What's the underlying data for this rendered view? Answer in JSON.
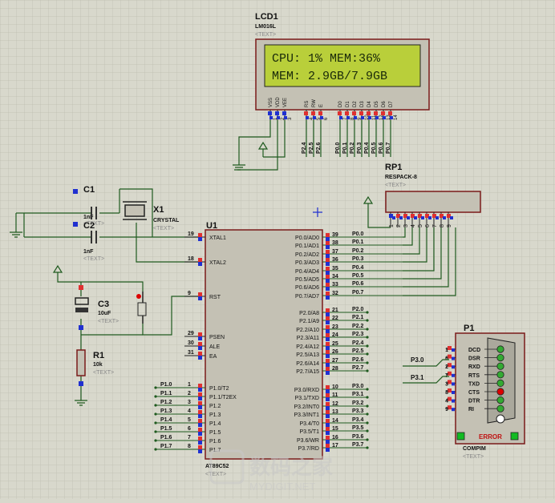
{
  "lcd": {
    "ref": "LCD1",
    "model": "LM016L",
    "text_tag": "<TEXT>",
    "line1": "CPU: 1% MEM:36%",
    "line2": "MEM: 2.9GB/7.9GB",
    "pin_names": [
      "VSS",
      "VDD",
      "VEE",
      "RS",
      "RW",
      "E",
      "D0",
      "D1",
      "D2",
      "D3",
      "D4",
      "D5",
      "D6",
      "D7"
    ],
    "pin_numbers": [
      "1",
      "2",
      "3",
      "4",
      "5",
      "6",
      "7",
      "8",
      "9",
      "10",
      "11",
      "12",
      "13",
      "14"
    ],
    "net_labels": [
      "P2.4",
      "P2.5",
      "P2.6",
      "P0.0",
      "P0.1",
      "P0.2",
      "P0.3",
      "P0.4",
      "P0.5",
      "P0.6",
      "P0.7"
    ]
  },
  "rp1": {
    "ref": "RP1",
    "model": "RESPACK-8",
    "text_tag": "<TEXT>",
    "pins": [
      "1",
      "2",
      "3",
      "4",
      "5",
      "6",
      "7",
      "8",
      "9"
    ]
  },
  "c1": {
    "ref": "C1",
    "value": "1nF",
    "text_tag": "<TEXT>"
  },
  "c2": {
    "ref": "C2",
    "value": "1nF",
    "text_tag": "<TEXT>"
  },
  "x1": {
    "ref": "X1",
    "model": "CRYSTAL",
    "text_tag": "<TEXT>"
  },
  "c3": {
    "ref": "C3",
    "value": "10uF",
    "text_tag": "<TEXT>"
  },
  "r1": {
    "ref": "R1",
    "value": "10k",
    "text_tag": "<TEXT>"
  },
  "u1": {
    "ref": "U1",
    "model": "AT89C52",
    "text_tag": "<TEXT>",
    "left_pins": [
      {
        "num": "19",
        "name": "XTAL1"
      },
      {
        "num": "18",
        "name": "XTAL2"
      },
      {
        "num": "9",
        "name": "RST"
      },
      {
        "num": "29",
        "name": "PSEN"
      },
      {
        "num": "30",
        "name": "ALE"
      },
      {
        "num": "31",
        "name": "EA"
      },
      {
        "num": "1",
        "name": "P1.0/T2",
        "net": "P1.0"
      },
      {
        "num": "2",
        "name": "P1.1/T2EX",
        "net": "P1.1"
      },
      {
        "num": "3",
        "name": "P1.2",
        "net": "P1.2"
      },
      {
        "num": "4",
        "name": "P1.3",
        "net": "P1.3"
      },
      {
        "num": "5",
        "name": "P1.4",
        "net": "P1.4"
      },
      {
        "num": "6",
        "name": "P1.5",
        "net": "P1.5"
      },
      {
        "num": "7",
        "name": "P1.6",
        "net": "P1.6"
      },
      {
        "num": "8",
        "name": "P1.7",
        "net": "P1.7"
      }
    ],
    "right_pins": [
      {
        "num": "39",
        "name": "P0.0/AD0",
        "net": "P0.0"
      },
      {
        "num": "38",
        "name": "P0.1/AD1",
        "net": "P0.1"
      },
      {
        "num": "37",
        "name": "P0.2/AD2",
        "net": "P0.2"
      },
      {
        "num": "36",
        "name": "P0.3/AD3",
        "net": "P0.3"
      },
      {
        "num": "35",
        "name": "P0.4/AD4",
        "net": "P0.4"
      },
      {
        "num": "34",
        "name": "P0.5/AD5",
        "net": "P0.5"
      },
      {
        "num": "33",
        "name": "P0.6/AD6",
        "net": "P0.6"
      },
      {
        "num": "32",
        "name": "P0.7/AD7",
        "net": "P0.7"
      },
      {
        "num": "21",
        "name": "P2.0/A8",
        "net": "P2.0"
      },
      {
        "num": "22",
        "name": "P2.1/A9",
        "net": "P2.1"
      },
      {
        "num": "23",
        "name": "P2.2/A10",
        "net": "P2.2"
      },
      {
        "num": "24",
        "name": "P2.3/A11",
        "net": "P2.3"
      },
      {
        "num": "25",
        "name": "P2.4/A12",
        "net": "P2.4"
      },
      {
        "num": "26",
        "name": "P2.5/A13",
        "net": "P2.5"
      },
      {
        "num": "27",
        "name": "P2.6/A14",
        "net": "P2.6"
      },
      {
        "num": "28",
        "name": "P2.7/A15",
        "net": "P2.7"
      },
      {
        "num": "10",
        "name": "P3.0/RXD",
        "net": "P3.0"
      },
      {
        "num": "11",
        "name": "P3.1/TXD",
        "net": "P3.1"
      },
      {
        "num": "12",
        "name": "P3.2/INT0",
        "net": "P3.2"
      },
      {
        "num": "13",
        "name": "P3.3/INT1",
        "net": "P3.3"
      },
      {
        "num": "14",
        "name": "P3.4/T0",
        "net": "P3.4"
      },
      {
        "num": "15",
        "name": "P3.5/T1",
        "net": "P3.5"
      },
      {
        "num": "16",
        "name": "P3.6/WR",
        "net": "P3.6"
      },
      {
        "num": "17",
        "name": "P3.7/RD",
        "net": "P3.7"
      }
    ]
  },
  "p1": {
    "ref": "P1",
    "model": "COMPIM",
    "text_tag": "<TEXT>",
    "error_label": "ERROR",
    "signals": [
      {
        "num": "1",
        "name": "DCD",
        "led": "#33aa33"
      },
      {
        "num": "6",
        "name": "DSR",
        "led": "#33aa33"
      },
      {
        "num": "2",
        "name": "RXD",
        "led": "#33aa33"
      },
      {
        "num": "7",
        "name": "RTS",
        "led": "#33aa33"
      },
      {
        "num": "3",
        "name": "TXD",
        "led": "#33aa33"
      },
      {
        "num": "8",
        "name": "CTS",
        "led": "#dd0000"
      },
      {
        "num": "4",
        "name": "DTR",
        "led": "#33aa33"
      },
      {
        "num": "9",
        "name": "RI",
        "led": "#33aa33"
      }
    ],
    "nets": [
      "P3.0",
      "P3.1"
    ]
  },
  "watermark": {
    "main": "数码之家",
    "sub": "MYDIGIT.NET"
  },
  "colors": {
    "wire": "#1e5a1e",
    "body": "#7a1a1a",
    "label": "#111111",
    "lcd_bg": "#b9cf3a",
    "lcd_text": "#1a2a0a",
    "pin_red": "#e03030",
    "pin_blue": "#2030d0",
    "tag": "#888888"
  }
}
